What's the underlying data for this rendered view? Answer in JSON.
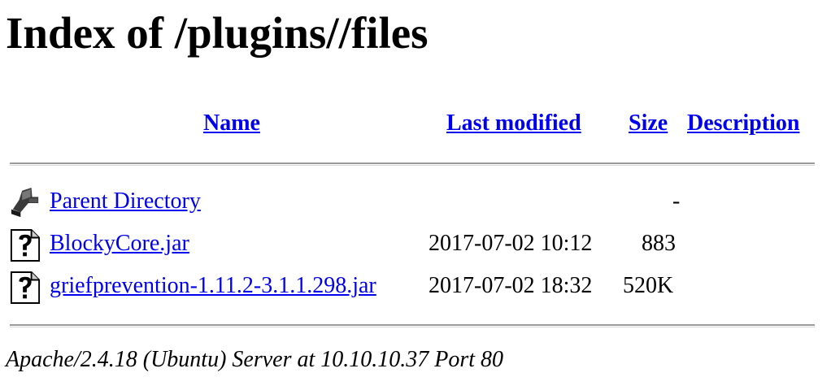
{
  "page_title": "Index of /plugins//files",
  "columns": {
    "name": "Name",
    "last_modified": "Last modified",
    "size": "Size",
    "description": "Description"
  },
  "rows": [
    {
      "icon": "parent-directory-icon",
      "name": "Parent Directory",
      "modified": "",
      "size": "-",
      "description": ""
    },
    {
      "icon": "unknown-file-icon",
      "name": "BlockyCore.jar",
      "modified": "2017-07-02 10:12",
      "size": "883",
      "description": ""
    },
    {
      "icon": "unknown-file-icon",
      "name": "griefprevention-1.11.2-3.1.1.298.jar",
      "modified": "2017-07-02 18:32",
      "size": "520K",
      "description": ""
    }
  ],
  "footer": "Apache/2.4.18 (Ubuntu) Server at 10.10.10.37 Port 80",
  "colors": {
    "link": "#0000ee",
    "text": "#000000",
    "background": "#ffffff"
  }
}
